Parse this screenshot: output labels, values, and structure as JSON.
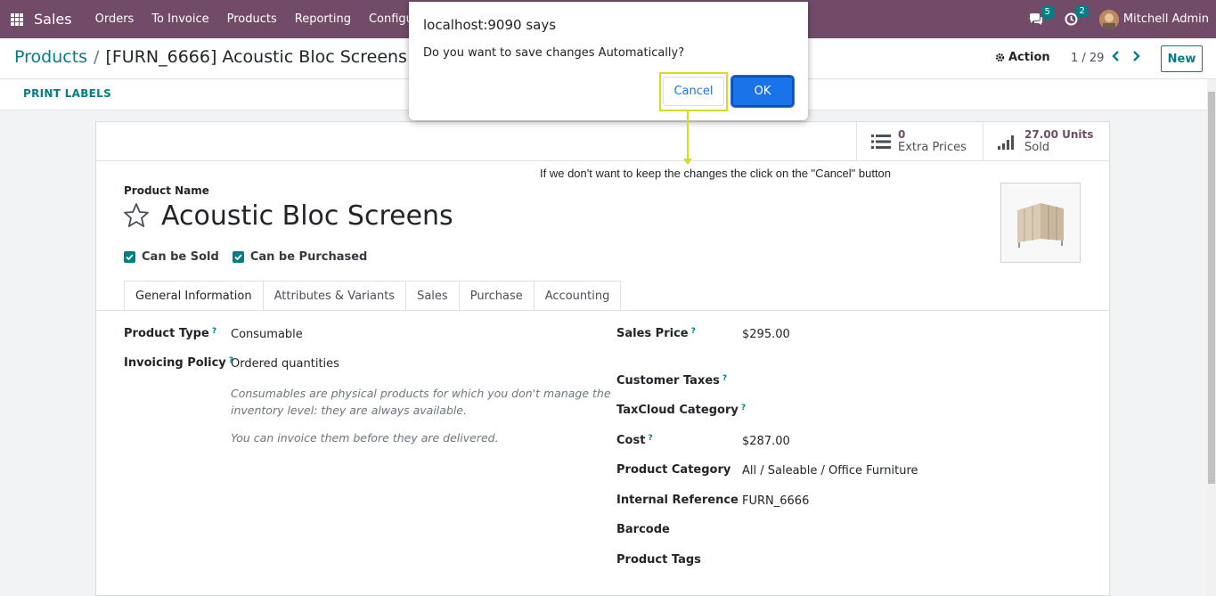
{
  "navbar": {
    "app_name": "Sales",
    "menu": [
      "Orders",
      "To Invoice",
      "Products",
      "Reporting",
      "Configu"
    ],
    "messages_count": "5",
    "activities_count": "2",
    "user_name": "Mitchell Admin"
  },
  "control": {
    "breadcrumb_root": "Products",
    "breadcrumb_separator": "/",
    "breadcrumb_current": "[FURN_6666] Acoustic Bloc Screens",
    "action_label": "Action",
    "pager": "1 / 29",
    "new_label": "New"
  },
  "statusbar": {
    "print_labels": "PRINT LABELS"
  },
  "smart_buttons": {
    "extra_prices_value": "0",
    "extra_prices_label": "Extra Prices",
    "sold_value": "27.00 Units",
    "sold_label": "Sold"
  },
  "product": {
    "name_label": "Product Name",
    "name": "Acoustic Bloc Screens",
    "can_be_sold": "Can be Sold",
    "can_be_purchased": "Can be Purchased"
  },
  "tabs": [
    "General Information",
    "Attributes & Variants",
    "Sales",
    "Purchase",
    "Accounting"
  ],
  "fields_left": {
    "product_type_label": "Product Type",
    "product_type_value": "Consumable",
    "invoicing_policy_label": "Invoicing Policy",
    "invoicing_policy_value": "Ordered quantities",
    "help_1_line1": "Consumables are physical products for which you don't manage the",
    "help_1_line2": "inventory level: they are always available.",
    "help_2": "You can invoice them before they are delivered."
  },
  "fields_right": {
    "sales_price_label": "Sales Price",
    "sales_price_value": "$295.00",
    "customer_taxes_label": "Customer Taxes",
    "taxcloud_label": "TaxCloud Category",
    "cost_label": "Cost",
    "cost_value": "$287.00",
    "category_label": "Product Category",
    "category_value": "All / Saleable / Office Furniture",
    "internal_ref_label": "Internal Reference",
    "internal_ref_value": "FURN_6666",
    "barcode_label": "Barcode",
    "tags_label": "Product Tags"
  },
  "help_marker": "?",
  "dialog": {
    "title": "localhost:9090 says",
    "message": "Do you want to save changes Automatically?",
    "cancel_label": "Cancel",
    "ok_label": "OK"
  },
  "annotation": "If we don't want to keep the changes the click on the \"Cancel\" button",
  "colors": {
    "navbar": "#714b67",
    "accent": "#017e84",
    "dialog_button": "#1a73e8",
    "highlight": "#d4dc1e"
  }
}
